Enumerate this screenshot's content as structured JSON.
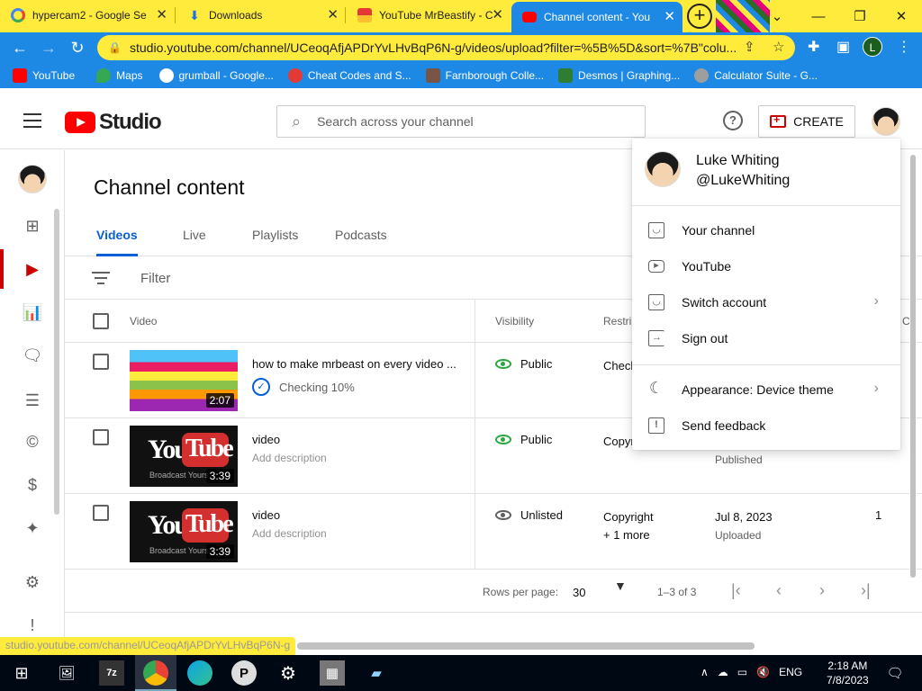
{
  "browser": {
    "tabs": [
      {
        "title": "hypercam2 - Google Se",
        "icon": "google-icon"
      },
      {
        "title": "Downloads",
        "icon": "download-icon"
      },
      {
        "title": "YouTube MrBeastify - C",
        "icon": "chrome-store-icon"
      },
      {
        "title": "Channel content - You",
        "icon": "youtube-studio-icon"
      }
    ],
    "url": "studio.youtube.com/channel/UCeoqAfjAPDrYvLHvBqP6N-g/videos/upload?filter=%5B%5D&sort=%7B\"colu...",
    "profile_initial": "L",
    "bookmarks": [
      {
        "label": "YouTube",
        "color": "#ff0000"
      },
      {
        "label": "Maps",
        "color": "#34a853"
      },
      {
        "label": "grumball - Google...",
        "color": "#ffffff"
      },
      {
        "label": "Cheat Codes and S...",
        "color": "#e53935"
      },
      {
        "label": "Farnborough Colle...",
        "color": "#795548"
      },
      {
        "label": "Desmos | Graphing...",
        "color": "#2e7d32"
      },
      {
        "label": "Calculator Suite - G...",
        "color": "#9e9e9e"
      }
    ]
  },
  "studio": {
    "logo_text": "Studio",
    "search_placeholder": "Search across your channel",
    "help_label": "?",
    "create_label": "CREATE",
    "page_title": "Channel content",
    "tabs": [
      "Videos",
      "Live",
      "Playlists",
      "Podcasts"
    ],
    "filter_placeholder": "Filter",
    "columns": {
      "video": "Video",
      "visibility": "Visibility",
      "restrictions": "Restri",
      "last": "C"
    },
    "rows": [
      {
        "title": "how to make mrbeast on every video ...",
        "status": "Checking 10%",
        "duration": "2:07",
        "visibility": "Public",
        "restrictions": "Check",
        "date": "",
        "date_sub": "",
        "views": ""
      },
      {
        "title": "video",
        "description": "Add description",
        "duration": "3:39",
        "visibility": "Public",
        "restrictions": "Copyr",
        "date": "",
        "date_sub": "Published",
        "views": ""
      },
      {
        "title": "video",
        "description": "Add description",
        "duration": "3:39",
        "visibility": "Unlisted",
        "restrictions": "Copyright",
        "restrictions_more": "+ 1 more",
        "date": "Jul 8, 2023",
        "date_sub": "Uploaded",
        "views": "1"
      }
    ],
    "thumb_text": {
      "you": "You",
      "tube": "Tube",
      "broadcast": "Broadcast Yours"
    },
    "pager": {
      "rows_label": "Rows per page:",
      "rows_value": "30",
      "range": "1–3 of 3"
    }
  },
  "account_menu": {
    "name": "Luke Whiting",
    "handle": "@LukeWhiting",
    "items": [
      {
        "label": "Your channel",
        "icon": "person-box-icon",
        "chevron": false
      },
      {
        "label": "YouTube",
        "icon": "youtube-icon",
        "chevron": false
      },
      {
        "label": "Switch account",
        "icon": "switch-account-icon",
        "chevron": true
      },
      {
        "label": "Sign out",
        "icon": "sign-out-icon",
        "chevron": false
      },
      {
        "label": "Appearance: Device theme",
        "icon": "moon-icon",
        "chevron": true
      },
      {
        "label": "Send feedback",
        "icon": "feedback-icon",
        "chevron": false
      }
    ]
  },
  "status_url": "studio.youtube.com/channel/UCeoqAfjAPDrYvLHvBqP6N-g",
  "taskbar": {
    "lang": "ENG",
    "time": "2:18 AM",
    "date": "7/8/2023",
    "app_7z": "7z",
    "app_p": "P"
  }
}
